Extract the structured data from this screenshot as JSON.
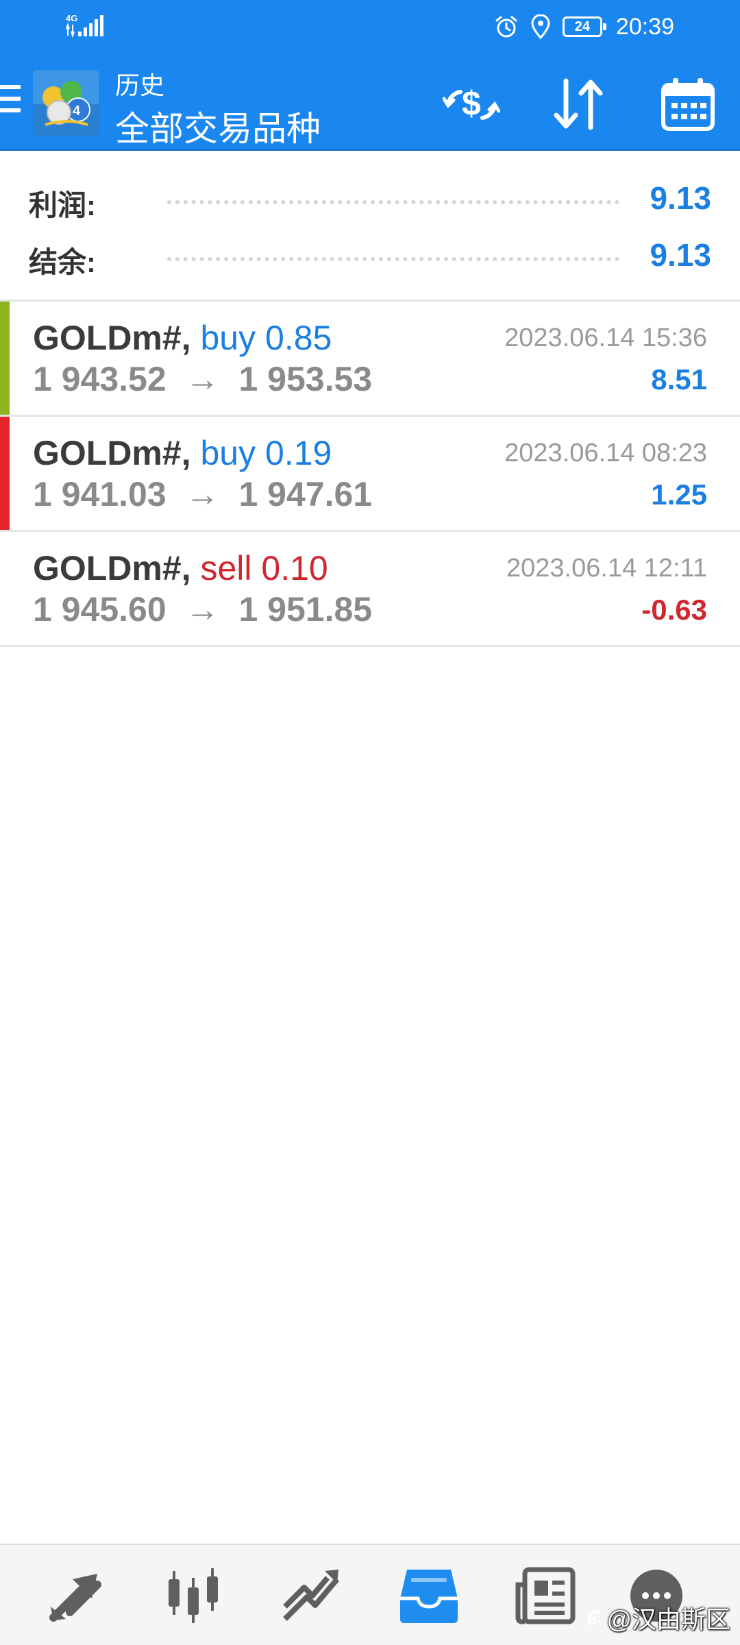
{
  "status_bar": {
    "network": "4G",
    "battery": "24",
    "time": "20:39"
  },
  "header": {
    "subtitle": "历史",
    "title": "全部交易品种"
  },
  "summary": {
    "profit_label": "利润:",
    "profit_value": "9.13",
    "balance_label": "结余:",
    "balance_value": "9.13"
  },
  "colors": {
    "accent": "#1a86f0",
    "buy": "#1a7fe0",
    "sell": "#d0262d",
    "profit_bar": "#8cb41e",
    "loss_bar": "#e3242b"
  },
  "deals": [
    {
      "symbol": "GOLDm#,",
      "action": "buy 0.85",
      "open_price": "1 943.52",
      "arrow": "→",
      "close_price": "1 953.53",
      "time": "2023.06.14 15:36",
      "profit": "8.51"
    },
    {
      "symbol": "GOLDm#,",
      "action": "buy 0.19",
      "open_price": "1 941.03",
      "arrow": "→",
      "close_price": "1 947.61",
      "time": "2023.06.14 08:23",
      "profit": "1.25"
    },
    {
      "symbol": "GOLDm#,",
      "action": "sell 0.10",
      "open_price": "1 945.60",
      "arrow": "→",
      "close_price": "1 951.85",
      "time": "2023.06.14 12:11",
      "profit": "-0.63"
    }
  ],
  "bottom_nav": {
    "icons": [
      "quotes-icon",
      "chart-icon",
      "trade-icon",
      "history-icon",
      "news-icon",
      "messages-icon"
    ],
    "active": "history-icon"
  },
  "watermark": "@汉由斯区"
}
